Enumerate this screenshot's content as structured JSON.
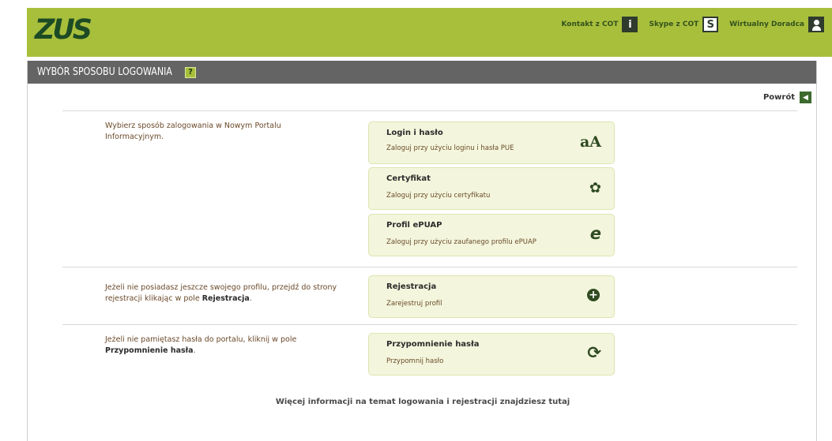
{
  "header": {
    "logo": "ZUS",
    "links": [
      {
        "label": "Kontakt z COT",
        "icon": "info-icon",
        "glyph": "i"
      },
      {
        "label": "Skype z COT",
        "icon": "skype-icon",
        "glyph": "S"
      },
      {
        "label": "Wirtualny Doradca",
        "icon": "user-icon",
        "glyph": ""
      }
    ],
    "accent_color": "#a8bf3c"
  },
  "panel": {
    "title": "WYBÓR SPOSOBU LOGOWANIA",
    "help": "?",
    "back_label": "Powrót",
    "back_glyph": "◀"
  },
  "sections": {
    "login_intro": "Wybierz sposób zalogowania w Nowym Portalu Informacyjnym.",
    "register_text": "Jeżeli nie posiadasz jeszcze swojego profilu, przejdź do strony rejestracji klikając w pole ",
    "register_bold": "Rejestracja",
    "register_end": ".",
    "remind_text": "Jeżeli nie pamiętasz hasła do portalu, kliknij w pole ",
    "remind_bold": "Przypomnienie hasła",
    "remind_end": "."
  },
  "cards": {
    "login": {
      "title": "Login i hasło",
      "sub": "Zaloguj przy użyciu loginu i hasła PUE",
      "icon": "login-password-icon",
      "glyph": "aA"
    },
    "cert": {
      "title": "Certyfikat",
      "sub": "Zaloguj przy użyciu certyfikatu",
      "icon": "certificate-icon",
      "glyph": "✿"
    },
    "epuap": {
      "title": "Profil ePUAP",
      "sub": "Zaloguj przy użyciu zaufanego profilu ePUAP",
      "icon": "epuap-icon",
      "glyph": "e"
    },
    "register": {
      "title": "Rejestracja",
      "sub": "Zarejestruj profil",
      "icon": "plus-icon",
      "glyph": "+"
    },
    "remind": {
      "title": "Przypomnienie hasła",
      "sub": "Przypomnij hasło",
      "icon": "refresh-icon",
      "glyph": "⟳"
    }
  },
  "footer": {
    "more_info": "Więcej informacji na temat logowania i rejestracji znajdziesz tutaj"
  }
}
